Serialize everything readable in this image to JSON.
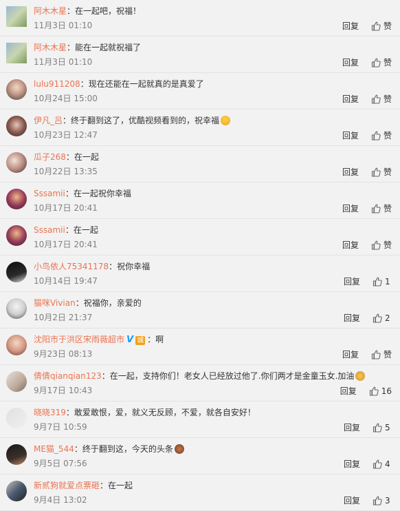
{
  "reply_label": "回复",
  "like_label": "赞",
  "comments": [
    {
      "user": "阿木木星",
      "text": "在一起吧，祝福！",
      "time": "11月3日 01:10",
      "likes": ""
    },
    {
      "user": "阿木木星",
      "text": "能在一起就祝福了",
      "time": "11月3日 01:10",
      "likes": ""
    },
    {
      "user": "lulu911208",
      "text": "现在还能在一起就真的是真爱了",
      "time": "10月24日 15:00",
      "likes": ""
    },
    {
      "user": "伊凡_吕",
      "text": "终于翻到这了，优酷视频看到的，祝幸福",
      "time": "10月23日 12:47",
      "likes": "",
      "emoji": "laugh-emoji"
    },
    {
      "user": "瓜子268",
      "text": "在一起",
      "time": "10月22日 13:35",
      "likes": ""
    },
    {
      "user": "Sssamii",
      "text": "在一起祝你幸福",
      "time": "10月17日 20:41",
      "likes": ""
    },
    {
      "user": "Sssamii",
      "text": "在一起",
      "time": "10月17日 20:41",
      "likes": ""
    },
    {
      "user": "小鸟依人75341178",
      "text": "祝你幸福",
      "time": "10月14日 19:47",
      "likes": "1"
    },
    {
      "user": "猫咪Vivian",
      "text": "祝福你，亲爱的",
      "time": "10月2日 21:37",
      "likes": "2"
    },
    {
      "user": "沈阳市于洪区宋雨薇超市",
      "text": "啊",
      "time": "9月23日 08:13",
      "likes": "",
      "verified": true,
      "fan_badge": "诚"
    },
    {
      "user": "倩倩qianqian123",
      "text": "在一起，支持你们！老女人已经放过他了.你们两才是金童玉女.加油",
      "time": "9月17日 10:43",
      "likes": "16",
      "emoji": "strong-emoji"
    },
    {
      "user": "晓晓319",
      "text": "敢爱敢恨，爱，就义无反顾，不爱，就各自安好！",
      "time": "9月7日 10:59",
      "likes": "5"
    },
    {
      "user": "ME猫_544",
      "text": "终于翻到这，今天的头条",
      "time": "9月5日 07:56",
      "likes": "4",
      "emoji": "paw-emoji"
    },
    {
      "user": "新贰狗就爱点票砸",
      "text": "在一起",
      "time": "9月4日 13:02",
      "likes": "3"
    }
  ],
  "colors": {
    "username": "#eb7350",
    "time": "#808080",
    "background": "#f2f2f2",
    "verified": "#1d9bf0"
  }
}
